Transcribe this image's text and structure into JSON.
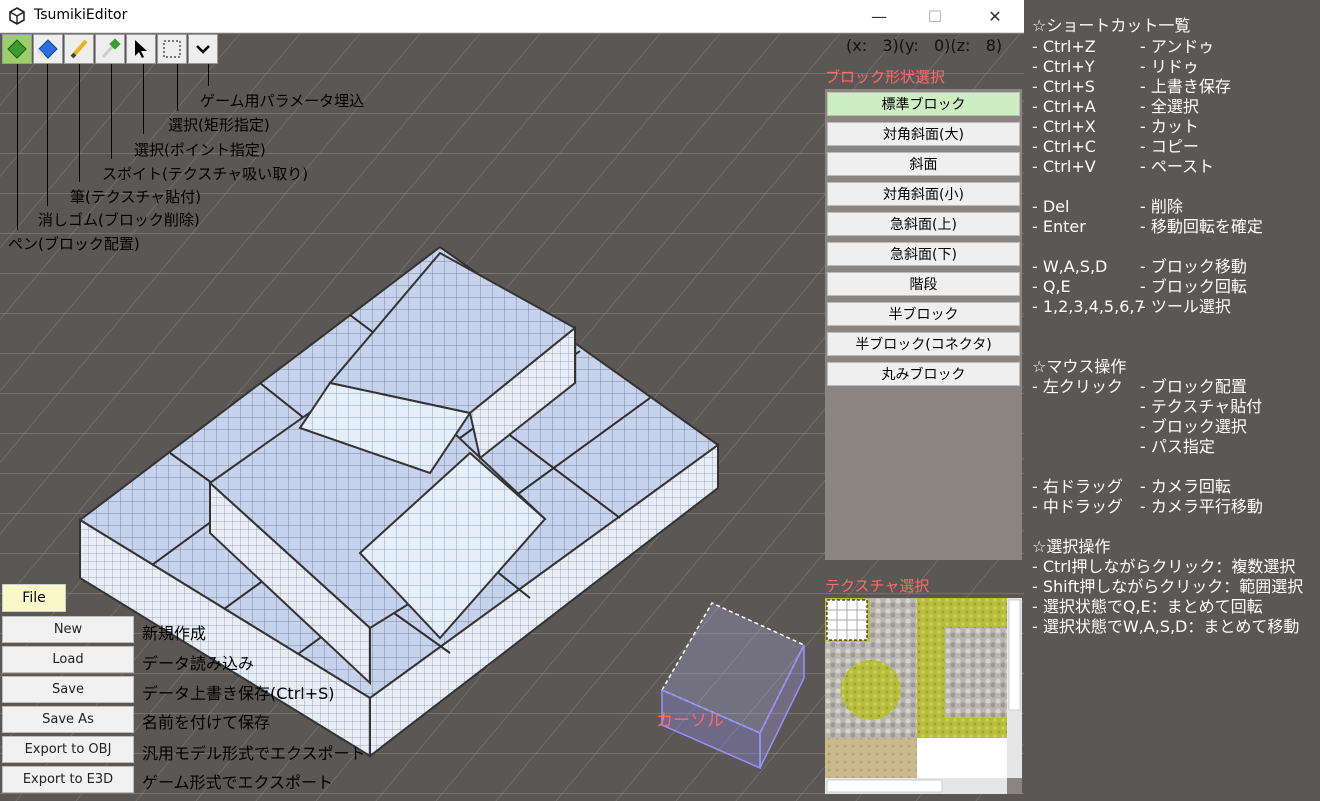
{
  "window": {
    "title": "TsumikiEditor",
    "minimize": "—",
    "maximize": "☐",
    "close": "✕"
  },
  "toolbar": {
    "tools": [
      {
        "name": "pen-icon",
        "label": "ペン(ブロック配置)"
      },
      {
        "name": "eraser-icon",
        "label": "消しゴム(ブロック削除)"
      },
      {
        "name": "brush-icon",
        "label": "筆(テクスチャ貼付)"
      },
      {
        "name": "eyedropper-icon",
        "label": "スポイト(テクスチャ吸い取り)"
      },
      {
        "name": "pointer-icon",
        "label": "選択(ポイント指定)"
      },
      {
        "name": "rect-select-icon",
        "label": "選択(矩形指定)"
      },
      {
        "name": "chevron-down-icon",
        "label": "ゲーム用パラメータ埋込"
      }
    ]
  },
  "coords": {
    "text": "(x:   3)(y:   0)(z:   8)"
  },
  "shape_panel": {
    "title": "ブロック形状選択",
    "buttons": [
      "標準ブロック",
      "対角斜面(大)",
      "斜面",
      "対角斜面(小)",
      "急斜面(上)",
      "急斜面(下)",
      "階段",
      "半ブロック",
      "半ブロック(コネクタ)",
      "丸みブロック"
    ],
    "selected_index": 0
  },
  "texture_panel": {
    "title": "テクスチャ選択"
  },
  "file_menu": {
    "file_label": "File",
    "items": [
      {
        "label": "New",
        "desc": "新規作成"
      },
      {
        "label": "Load",
        "desc": "データ読み込み"
      },
      {
        "label": "Save",
        "desc": "データ上書き保存(Ctrl+S)"
      },
      {
        "label": "Save As",
        "desc": "名前を付けて保存"
      },
      {
        "label": "Export to OBJ",
        "desc": "汎用モデル形式でエクスポート"
      },
      {
        "label": "Export to E3D",
        "desc": "ゲーム形式でエクスポート"
      }
    ]
  },
  "cursor_label": "カーソル",
  "help": {
    "title": "☆ショートカット一覧",
    "shortcuts": [
      {
        "k": "- Ctrl+Z",
        "v": "- アンドゥ"
      },
      {
        "k": "- Ctrl+Y",
        "v": "- リドゥ"
      },
      {
        "k": "- Ctrl+S",
        "v": "- 上書き保存"
      },
      {
        "k": "- Ctrl+A",
        "v": "- 全選択"
      },
      {
        "k": "- Ctrl+X",
        "v": "- カット"
      },
      {
        "k": "- Ctrl+C",
        "v": "- コピー"
      },
      {
        "k": "- Ctrl+V",
        "v": "- ペースト"
      },
      {
        "k": "- Del",
        "v": "- 削除"
      },
      {
        "k": "- Enter",
        "v": "- 移動回転を確定"
      },
      {
        "k": "- W,A,S,D",
        "v": "- ブロック移動"
      },
      {
        "k": "- Q,E",
        "v": "- ブロック回転"
      },
      {
        "k": "- 1,2,3,4,5,6,7",
        "v": "- ツール選択"
      }
    ],
    "mouse_title": "☆マウス操作",
    "mouse": [
      {
        "k": "- 左クリック",
        "v": "- ブロック配置"
      },
      {
        "k": "",
        "v": "- テクスチャ貼付"
      },
      {
        "k": "",
        "v": "- ブロック選択"
      },
      {
        "k": "",
        "v": "- パス指定"
      },
      {
        "k": "- 右ドラッグ",
        "v": "- カメラ回転"
      },
      {
        "k": "- 中ドラッグ",
        "v": "- カメラ平行移動"
      }
    ],
    "select_title": "☆選択操作",
    "select": [
      "- Ctrl押しながらクリック：複数選択",
      "- Shift押しながらクリック：範囲選択",
      "- 選択状態でQ,E：まとめて回転",
      "- 選択状態でW,A,S,D：まとめて移動"
    ]
  }
}
